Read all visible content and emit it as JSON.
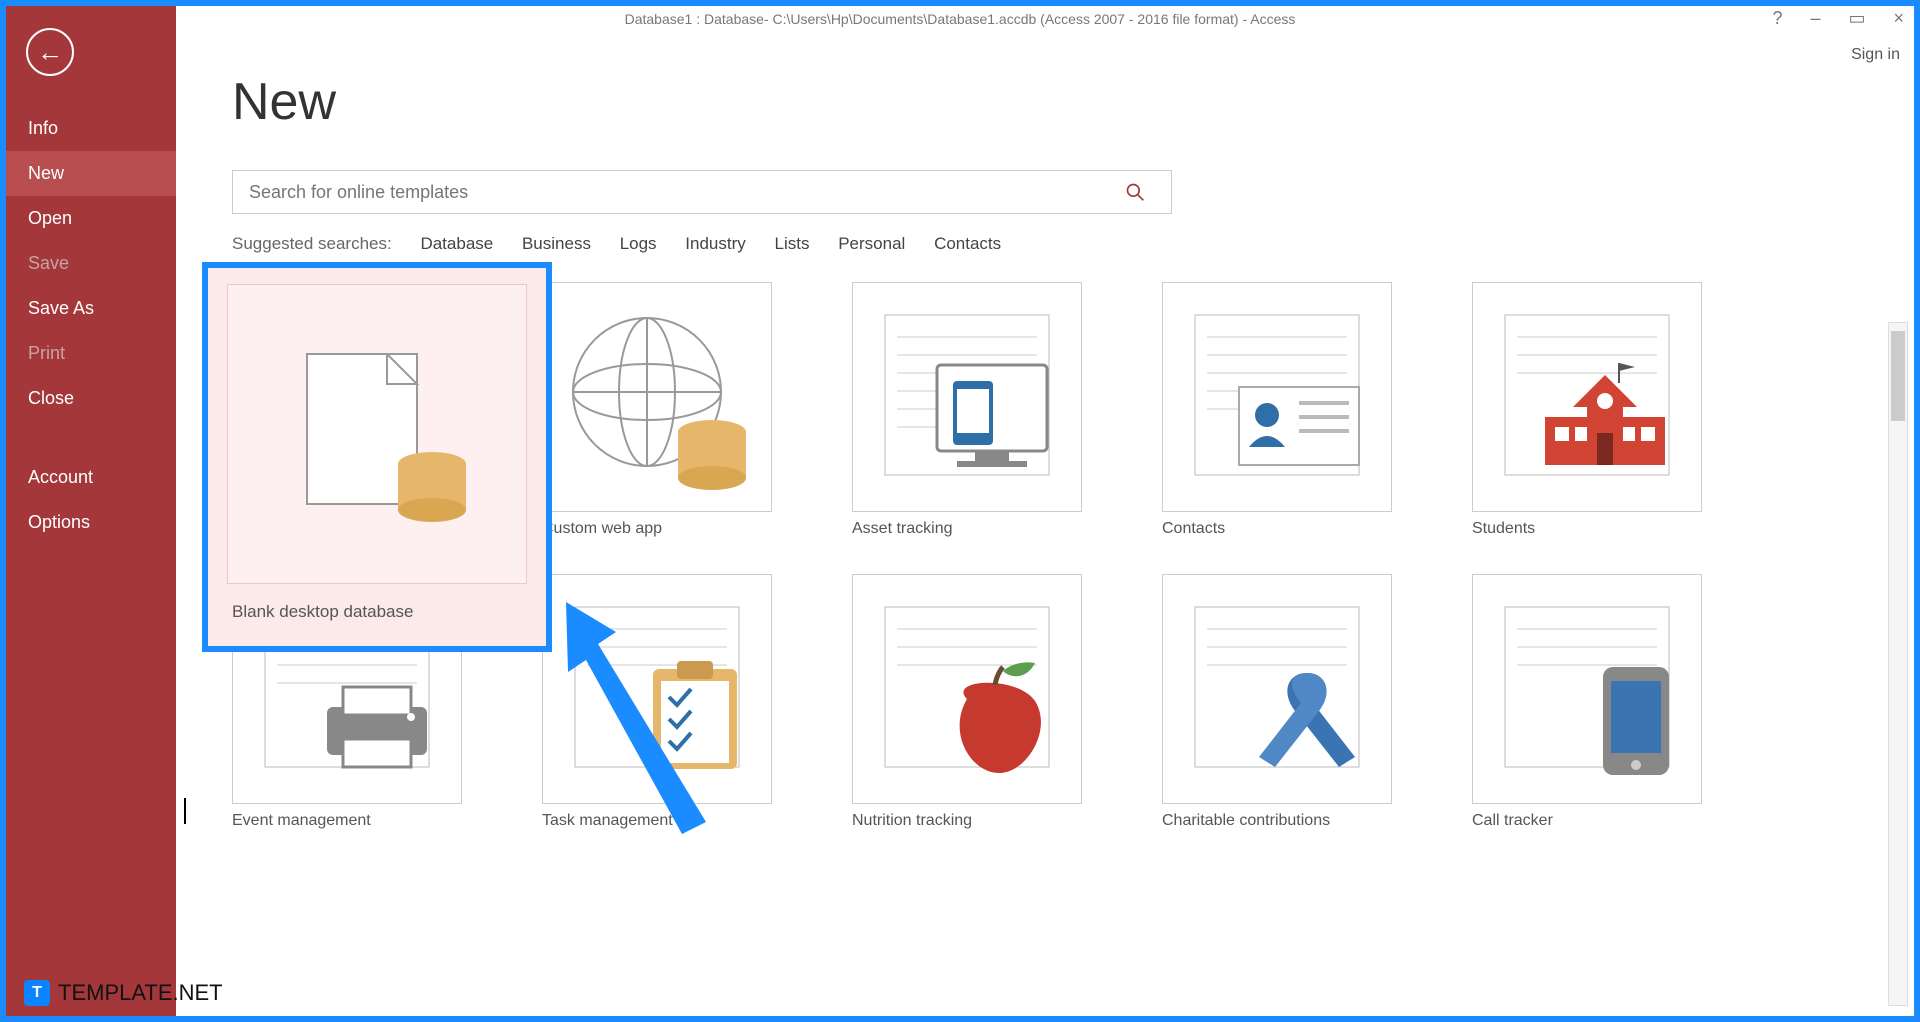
{
  "titlebar": {
    "title": "Database1 : Database- C:\\Users\\Hp\\Documents\\Database1.accdb (Access 2007 - 2016 file format) - Access"
  },
  "window_controls": {
    "help": "?",
    "minimize": "–",
    "maximize": "▭",
    "close": "×"
  },
  "signin": {
    "label": "Sign in"
  },
  "sidebar": {
    "items": [
      {
        "label": "Info",
        "active": false,
        "disabled": false
      },
      {
        "label": "New",
        "active": true,
        "disabled": false
      },
      {
        "label": "Open",
        "active": false,
        "disabled": false
      },
      {
        "label": "Save",
        "active": false,
        "disabled": true
      },
      {
        "label": "Save As",
        "active": false,
        "disabled": false
      },
      {
        "label": "Print",
        "active": false,
        "disabled": true
      },
      {
        "label": "Close",
        "active": false,
        "disabled": false
      },
      {
        "label": "Account",
        "active": false,
        "disabled": false
      },
      {
        "label": "Options",
        "active": false,
        "disabled": false
      }
    ]
  },
  "page": {
    "title": "New"
  },
  "search": {
    "placeholder": "Search for online templates"
  },
  "suggested": {
    "label": "Suggested searches:",
    "items": [
      "Database",
      "Business",
      "Logs",
      "Industry",
      "Lists",
      "Personal",
      "Contacts"
    ]
  },
  "templates": [
    {
      "label": "Blank desktop database",
      "highlighted": true
    },
    {
      "label": "Custom web app",
      "highlighted": false
    },
    {
      "label": "Asset tracking",
      "highlighted": false
    },
    {
      "label": "Contacts",
      "highlighted": false
    },
    {
      "label": "Students",
      "highlighted": false
    },
    {
      "label": "Event management",
      "highlighted": false
    },
    {
      "label": "Task management",
      "highlighted": false
    },
    {
      "label": "Nutrition tracking",
      "highlighted": false
    },
    {
      "label": "Charitable contributions",
      "highlighted": false
    },
    {
      "label": "Call tracker",
      "highlighted": false
    }
  ],
  "watermark": {
    "text": "TEMPLATE.NET",
    "badge": "T"
  },
  "colors": {
    "accent": "#a4373a",
    "highlight": "#1a8cff"
  }
}
